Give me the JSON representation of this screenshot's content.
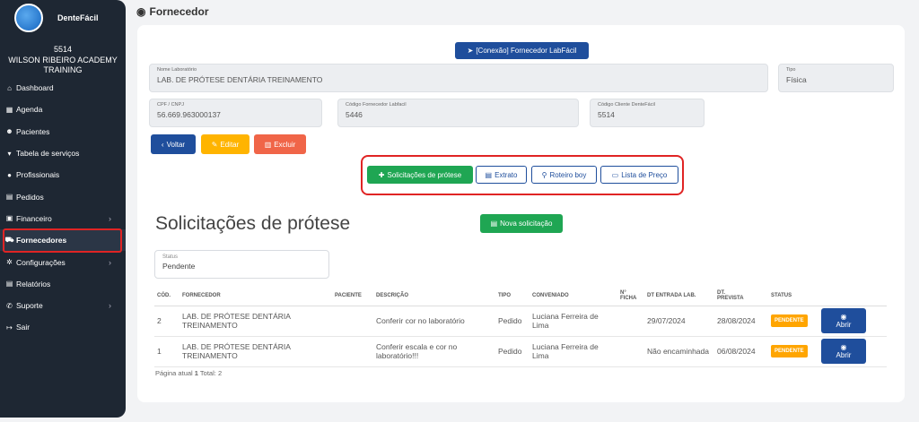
{
  "sidebar": {
    "brand": "DenteFácil",
    "client_code": "5514",
    "client_name": "WILSON RIBEIRO ACADEMY TRAINING",
    "items": [
      {
        "label": "Dashboard",
        "icon": "home-icon",
        "glyph": "⌂",
        "chevron": false,
        "active": false
      },
      {
        "label": "Agenda",
        "icon": "calendar-icon",
        "glyph": "▦",
        "chevron": false,
        "active": false
      },
      {
        "label": "Pacientes",
        "icon": "users-icon",
        "glyph": "☻",
        "chevron": false,
        "active": false
      },
      {
        "label": "Tabela de serviços",
        "icon": "tag-icon",
        "glyph": "▾",
        "chevron": false,
        "active": false
      },
      {
        "label": "Profissionais",
        "icon": "user-icon",
        "glyph": "●",
        "chevron": false,
        "active": false
      },
      {
        "label": "Pedidos",
        "icon": "file-icon",
        "glyph": "▤",
        "chevron": false,
        "active": false
      },
      {
        "label": "Financeiro",
        "icon": "money-icon",
        "glyph": "▣",
        "chevron": true,
        "active": false
      },
      {
        "label": "Fornecedores",
        "icon": "truck-icon",
        "glyph": "⛟",
        "chevron": false,
        "active": true
      },
      {
        "label": "Configurações",
        "icon": "gear-icon",
        "glyph": "✲",
        "chevron": true,
        "active": false
      },
      {
        "label": "Relatórios",
        "icon": "report-icon",
        "glyph": "▤",
        "chevron": false,
        "active": false
      },
      {
        "label": "Suporte",
        "icon": "phone-icon",
        "glyph": "✆",
        "chevron": true,
        "active": false
      },
      {
        "label": "Sair",
        "icon": "logout-icon",
        "glyph": "↦",
        "chevron": false,
        "active": false
      }
    ]
  },
  "header": {
    "title": "Fornecedor",
    "icon": "eye-icon"
  },
  "connect_button": "[Conexão] Fornecedor LabFácil",
  "fields": {
    "nome_label": "Nome Laboratório",
    "nome_value": "LAB. DE PRÓTESE DENTÁRIA TREINAMENTO",
    "tipo_label": "Tipo",
    "tipo_value": "Física",
    "cpf_label": "CPF / CNPJ",
    "cpf_value": "56.669.963000137",
    "codigo_forn_label": "Código Fornecedor Labfacil",
    "codigo_forn_value": "5446",
    "codigo_cli_label": "Código Cliente DenteFácil",
    "codigo_cli_value": "5514"
  },
  "actions": {
    "voltar": "Voltar",
    "editar": "Editar",
    "excluir": "Excluir"
  },
  "tabs": {
    "solicitacoes": "Solicitações de prótese",
    "extrato": "Extrato",
    "roteiro": "Roteiro boy",
    "lista": "Lista de Preço"
  },
  "section": {
    "title": "Solicitações de prótese",
    "new_button": "Nova solicitação"
  },
  "status_filter": {
    "label": "Status",
    "value": "Pendente"
  },
  "table": {
    "headers": {
      "cod": "CÓD.",
      "fornecedor": "FORNECEDOR",
      "paciente": "PACIENTE",
      "descricao": "DESCRIÇÃO",
      "tipo": "TIPO",
      "conveniado": "CONVENIADO",
      "ficha_line1": "N°",
      "ficha_line2": "FICHA",
      "entrada": "DT ENTRADA LAB.",
      "prevista_line1": "DT.",
      "prevista_line2": "PREVISTA",
      "status": "STATUS"
    },
    "rows": [
      {
        "cod": "2",
        "fornecedor": "LAB. DE PRÓTESE DENTÁRIA TREINAMENTO",
        "paciente": "",
        "descricao": "Conferir cor no laboratório",
        "tipo": "Pedido",
        "conveniado": "Luciana Ferreira de Lima",
        "ficha": "",
        "entrada": "29/07/2024",
        "prevista": "28/08/2024",
        "status": "PENDENTE",
        "action": "Abrir"
      },
      {
        "cod": "1",
        "fornecedor": "LAB. DE PRÓTESE DENTÁRIA TREINAMENTO",
        "paciente": "",
        "descricao": "Conferir escala e cor no laboratório!!!",
        "tipo": "Pedido",
        "conveniado": "Luciana Ferreira de Lima",
        "ficha": "",
        "entrada": "Não encaminhada",
        "prevista": "06/08/2024",
        "status": "PENDENTE",
        "action": "Abrir"
      }
    ]
  },
  "pagination": {
    "label": "Página atual",
    "current": "1",
    "total_label": "Total:",
    "total": "2"
  },
  "colors": {
    "sidebar_bg": "#1e2733",
    "primary": "#1f4e9c",
    "success": "#1fa653",
    "warning": "#ffb400",
    "danger": "#f06548",
    "badge": "#ffa500",
    "highlight": "#e02424"
  }
}
